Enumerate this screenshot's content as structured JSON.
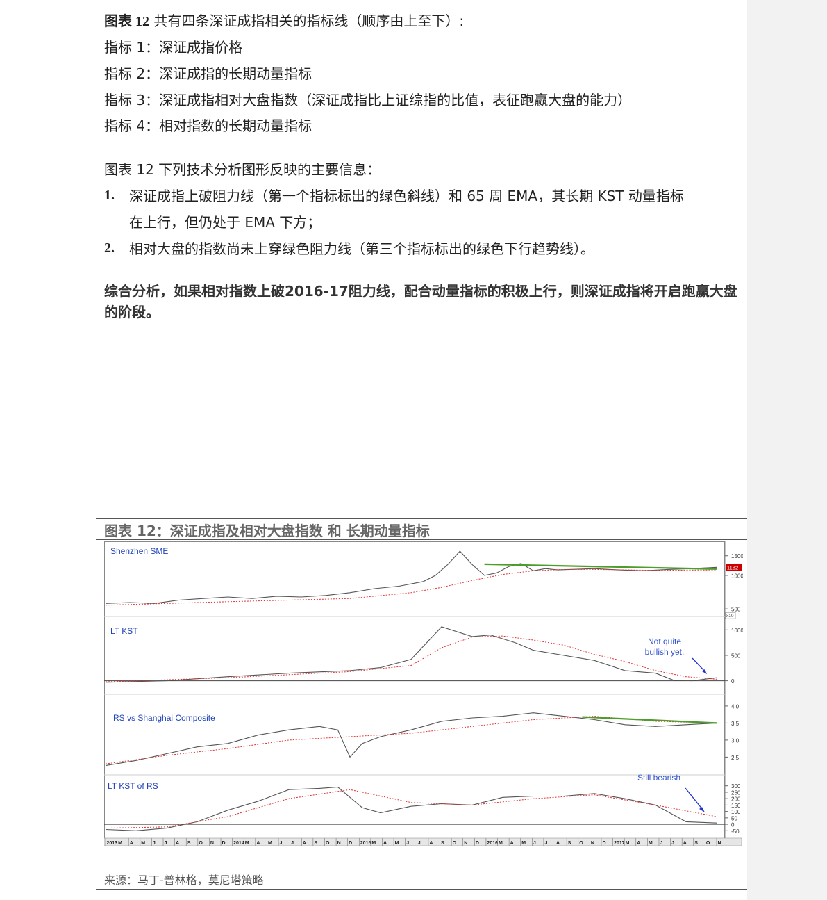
{
  "intro": {
    "line1_bold": "图表 12",
    "line1_rest": "共有四条深证成指相关的指标线（顺序由上至下）:",
    "ind1": "指标 1：深证成指价格",
    "ind2": "指标 2：深证成指的长期动量指标",
    "ind3": "指标 3：深证成指相对大盘指数（深证成指比上证综指的比值，表征跑赢大盘的能力）",
    "ind4": "指标 4：相对指数的长期动量指标"
  },
  "info_title": "图表 12  下列技术分析图形反映的主要信息：",
  "list": [
    {
      "num": "1.",
      "line1": "深证成指上破阻力线（第一个指标标出的绿色斜线）和 65 周 EMA，其长期 KST 动量指标",
      "line2": "在上行，但仍处于 EMA 下方；"
    },
    {
      "num": "2.",
      "line1": "相对大盘的指数尚未上穿绿色阻力线（第三个指标标出的绿色下行趋势线）。",
      "line2": ""
    }
  ],
  "summary": "综合分析，如果相对指数上破2016-17阻力线，配合动量指标的积极上行，则深证成指将开启跑赢大盘的阶段。",
  "figure": {
    "title": "图表 12：深证成指及相对大盘指数 和 长期动量指标",
    "source": "来源：马丁-普林格，莫尼塔策略"
  },
  "chart_data": {
    "type": "line",
    "x_range": [
      "2013-01",
      "2017-11"
    ],
    "x_ticks": [
      "2013",
      "M",
      "A",
      "M",
      "J",
      "J",
      "A",
      "S",
      "O",
      "N",
      "D",
      "2014",
      "M",
      "A",
      "M",
      "J",
      "J",
      "A",
      "S",
      "O",
      "N",
      "D",
      "2015",
      "M",
      "A",
      "M",
      "J",
      "J",
      "A",
      "S",
      "O",
      "N",
      "D",
      "2016",
      "M",
      "A",
      "M",
      "J",
      "J",
      "A",
      "S",
      "O",
      "N",
      "D",
      "2017",
      "M",
      "A",
      "M",
      "J",
      "J",
      "A",
      "S",
      "O",
      "N"
    ],
    "panels": [
      {
        "label": "Shenzhen SME",
        "scale": "log",
        "y_ticks": [
          "1500",
          "1000",
          "500"
        ],
        "y_unit": "x10",
        "last_value": "1182",
        "series": [
          {
            "style": "price",
            "x": [
              0,
              0.04,
              0.08,
              0.12,
              0.16,
              0.2,
              0.24,
              0.28,
              0.32,
              0.36,
              0.4,
              0.44,
              0.48,
              0.52,
              0.54,
              0.56,
              0.58,
              0.6,
              0.62,
              0.64,
              0.66,
              0.68,
              0.7,
              0.72,
              0.74,
              0.76,
              0.8,
              0.84,
              0.88,
              0.92,
              0.96,
              1.0
            ],
            "y": [
              560,
              570,
              560,
              600,
              620,
              640,
              620,
              650,
              640,
              660,
              700,
              760,
              800,
              880,
              1000,
              1250,
              1650,
              1250,
              1000,
              1050,
              1200,
              1280,
              1100,
              1150,
              1120,
              1130,
              1150,
              1120,
              1100,
              1130,
              1150,
              1182
            ]
          },
          {
            "style": "ema",
            "x": [
              0,
              0.2,
              0.4,
              0.5,
              0.55,
              0.6,
              0.65,
              0.7,
              0.75,
              0.8,
              0.9,
              1.0
            ],
            "y": [
              540,
              580,
              620,
              700,
              780,
              900,
              1020,
              1100,
              1130,
              1130,
              1110,
              1120
            ]
          },
          {
            "style": "trendline",
            "x": [
              0.62,
              1.0
            ],
            "y": [
              1260,
              1140
            ]
          }
        ]
      },
      {
        "label": "LT KST",
        "y_ticks": [
          "1000",
          "500",
          "0"
        ],
        "annotation": "Not quite bullish yet.",
        "series": [
          {
            "style": "indicator",
            "x": [
              0,
              0.1,
              0.2,
              0.3,
              0.4,
              0.45,
              0.5,
              0.55,
              0.6,
              0.63,
              0.67,
              0.7,
              0.75,
              0.8,
              0.85,
              0.9,
              0.93,
              0.96,
              1.0
            ],
            "y": [
              -30,
              0,
              80,
              150,
              200,
              260,
              420,
              1060,
              870,
              900,
              750,
              600,
              500,
              400,
              200,
              150,
              10,
              0,
              60
            ]
          },
          {
            "style": "signal",
            "x": [
              0,
              0.2,
              0.4,
              0.5,
              0.55,
              0.6,
              0.65,
              0.7,
              0.75,
              0.8,
              0.85,
              0.9,
              0.95,
              1.0
            ],
            "y": [
              -20,
              60,
              180,
              300,
              650,
              860,
              880,
              800,
              700,
              520,
              380,
              200,
              80,
              30
            ]
          }
        ]
      },
      {
        "label": "RS vs Shanghai Composite",
        "y_ticks": [
          "4.0",
          "3.5",
          "3.0",
          "2.5"
        ],
        "series": [
          {
            "style": "price",
            "x": [
              0,
              0.05,
              0.1,
              0.15,
              0.2,
              0.25,
              0.3,
              0.35,
              0.38,
              0.4,
              0.42,
              0.45,
              0.5,
              0.55,
              0.6,
              0.65,
              0.7,
              0.75,
              0.8,
              0.85,
              0.9,
              0.95,
              1.0
            ],
            "y": [
              2.25,
              2.4,
              2.6,
              2.8,
              2.9,
              3.15,
              3.3,
              3.4,
              3.3,
              2.5,
              2.9,
              3.1,
              3.3,
              3.55,
              3.65,
              3.7,
              3.8,
              3.7,
              3.6,
              3.45,
              3.4,
              3.45,
              3.5
            ]
          },
          {
            "style": "ema",
            "x": [
              0,
              0.1,
              0.2,
              0.3,
              0.4,
              0.5,
              0.6,
              0.7,
              0.8,
              0.9,
              1.0
            ],
            "y": [
              2.3,
              2.55,
              2.75,
              3.0,
              3.1,
              3.2,
              3.4,
              3.6,
              3.7,
              3.55,
              3.5
            ]
          },
          {
            "style": "trendline",
            "x": [
              0.78,
              1.0
            ],
            "y": [
              3.68,
              3.5
            ]
          }
        ]
      },
      {
        "label": "LT KST of RS",
        "y_ticks": [
          "300",
          "250",
          "200",
          "150",
          "100",
          "50",
          "0",
          "-50"
        ],
        "annotation": "Still bearish",
        "series": [
          {
            "style": "indicator",
            "x": [
              0,
              0.05,
              0.1,
              0.15,
              0.2,
              0.25,
              0.3,
              0.35,
              0.38,
              0.42,
              0.45,
              0.5,
              0.55,
              0.6,
              0.65,
              0.7,
              0.75,
              0.8,
              0.85,
              0.9,
              0.95,
              1.0
            ],
            "y": [
              -40,
              -50,
              -30,
              20,
              110,
              180,
              270,
              280,
              290,
              130,
              90,
              140,
              160,
              150,
              210,
              220,
              220,
              240,
              200,
              150,
              20,
              10
            ]
          },
          {
            "style": "signal",
            "x": [
              0,
              0.1,
              0.2,
              0.3,
              0.4,
              0.5,
              0.6,
              0.7,
              0.8,
              0.9,
              1.0
            ],
            "y": [
              -30,
              -20,
              60,
              200,
              270,
              170,
              150,
              200,
              230,
              150,
              60
            ]
          }
        ]
      }
    ]
  },
  "colors": {
    "price": "#555555",
    "ema": "#e03030",
    "trendline": "#4c9e2a",
    "annotation": "#3355cc",
    "arrow": "#2233cc",
    "badge": "#cc0000"
  }
}
